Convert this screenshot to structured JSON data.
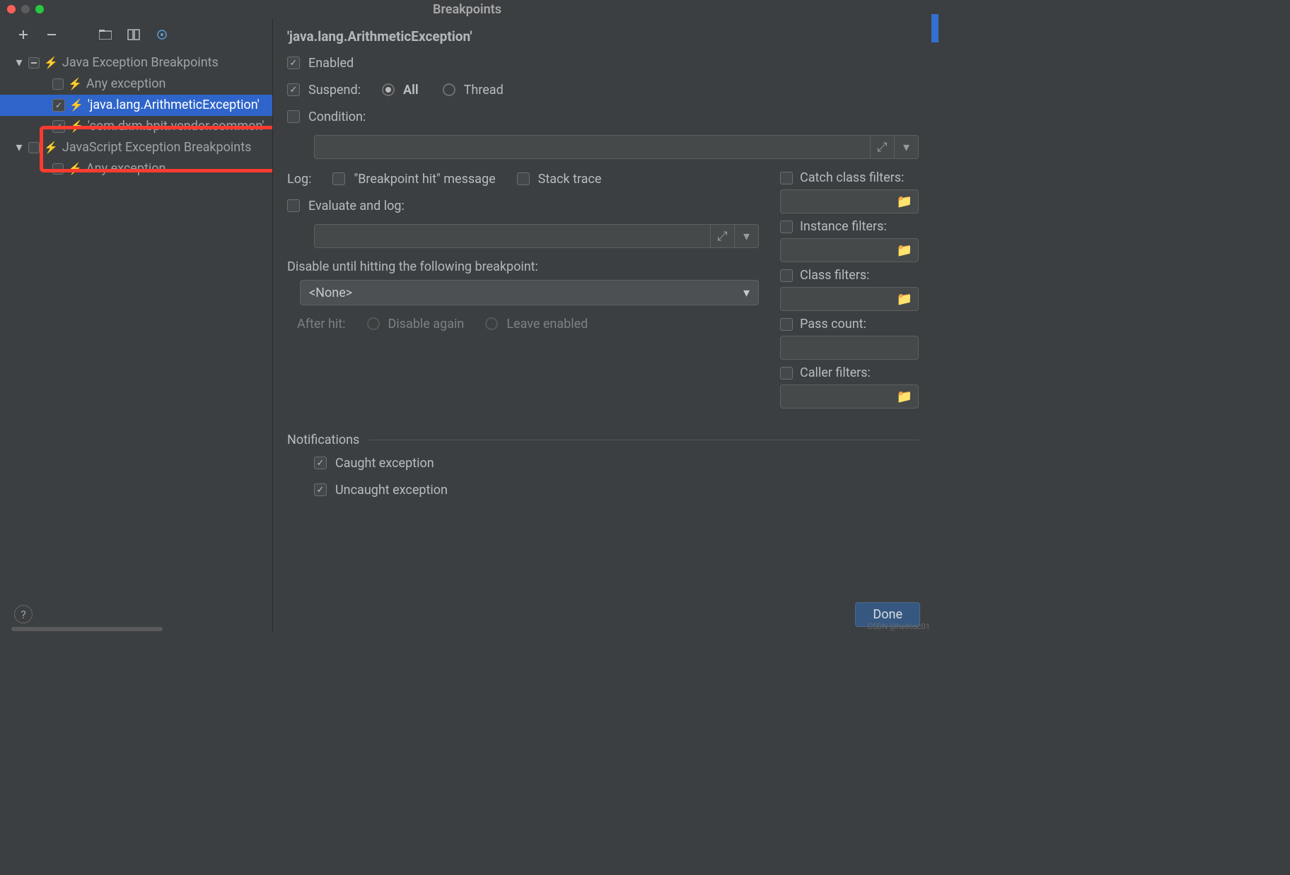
{
  "title": "Breakpoints",
  "sidebar": {
    "groups": [
      {
        "label": "Java Exception Breakpoints",
        "state": "minus",
        "children": [
          {
            "label": "Any exception",
            "checked": false
          },
          {
            "label": "'java.lang.ArithmeticException'",
            "checked": true,
            "selected": true
          },
          {
            "label": "'com.dxm.bpit.vendor.common'",
            "checked": true
          }
        ]
      },
      {
        "label": "JavaScript Exception Breakpoints",
        "state": "empty",
        "children": [
          {
            "label": "Any exception",
            "checked": false
          }
        ]
      }
    ]
  },
  "details": {
    "title": "'java.lang.ArithmeticException'",
    "enabled": {
      "label": "Enabled",
      "checked": true
    },
    "suspend": {
      "label": "Suspend:",
      "checked": true,
      "all": "All",
      "thread": "Thread",
      "value": "all"
    },
    "condition": {
      "label": "Condition:",
      "checked": false
    },
    "log_label": "Log:",
    "log_hit": "\"Breakpoint hit\" message",
    "log_stack": "Stack trace",
    "eval": {
      "label": "Evaluate and log:",
      "checked": false
    },
    "disable_label": "Disable until hitting the following breakpoint:",
    "disable_value": "<None>",
    "after_hit": {
      "label": "After hit:",
      "disable": "Disable again",
      "leave": "Leave enabled"
    },
    "filters": {
      "catch": "Catch class filters:",
      "instance": "Instance filters:",
      "class": "Class filters:",
      "pass": "Pass count:",
      "caller": "Caller filters:"
    },
    "notifications": {
      "label": "Notifications",
      "caught": "Caught exception",
      "uncaught": "Uncaught exception"
    }
  },
  "done": "Done",
  "watermark": "CSDN @hellosc01"
}
